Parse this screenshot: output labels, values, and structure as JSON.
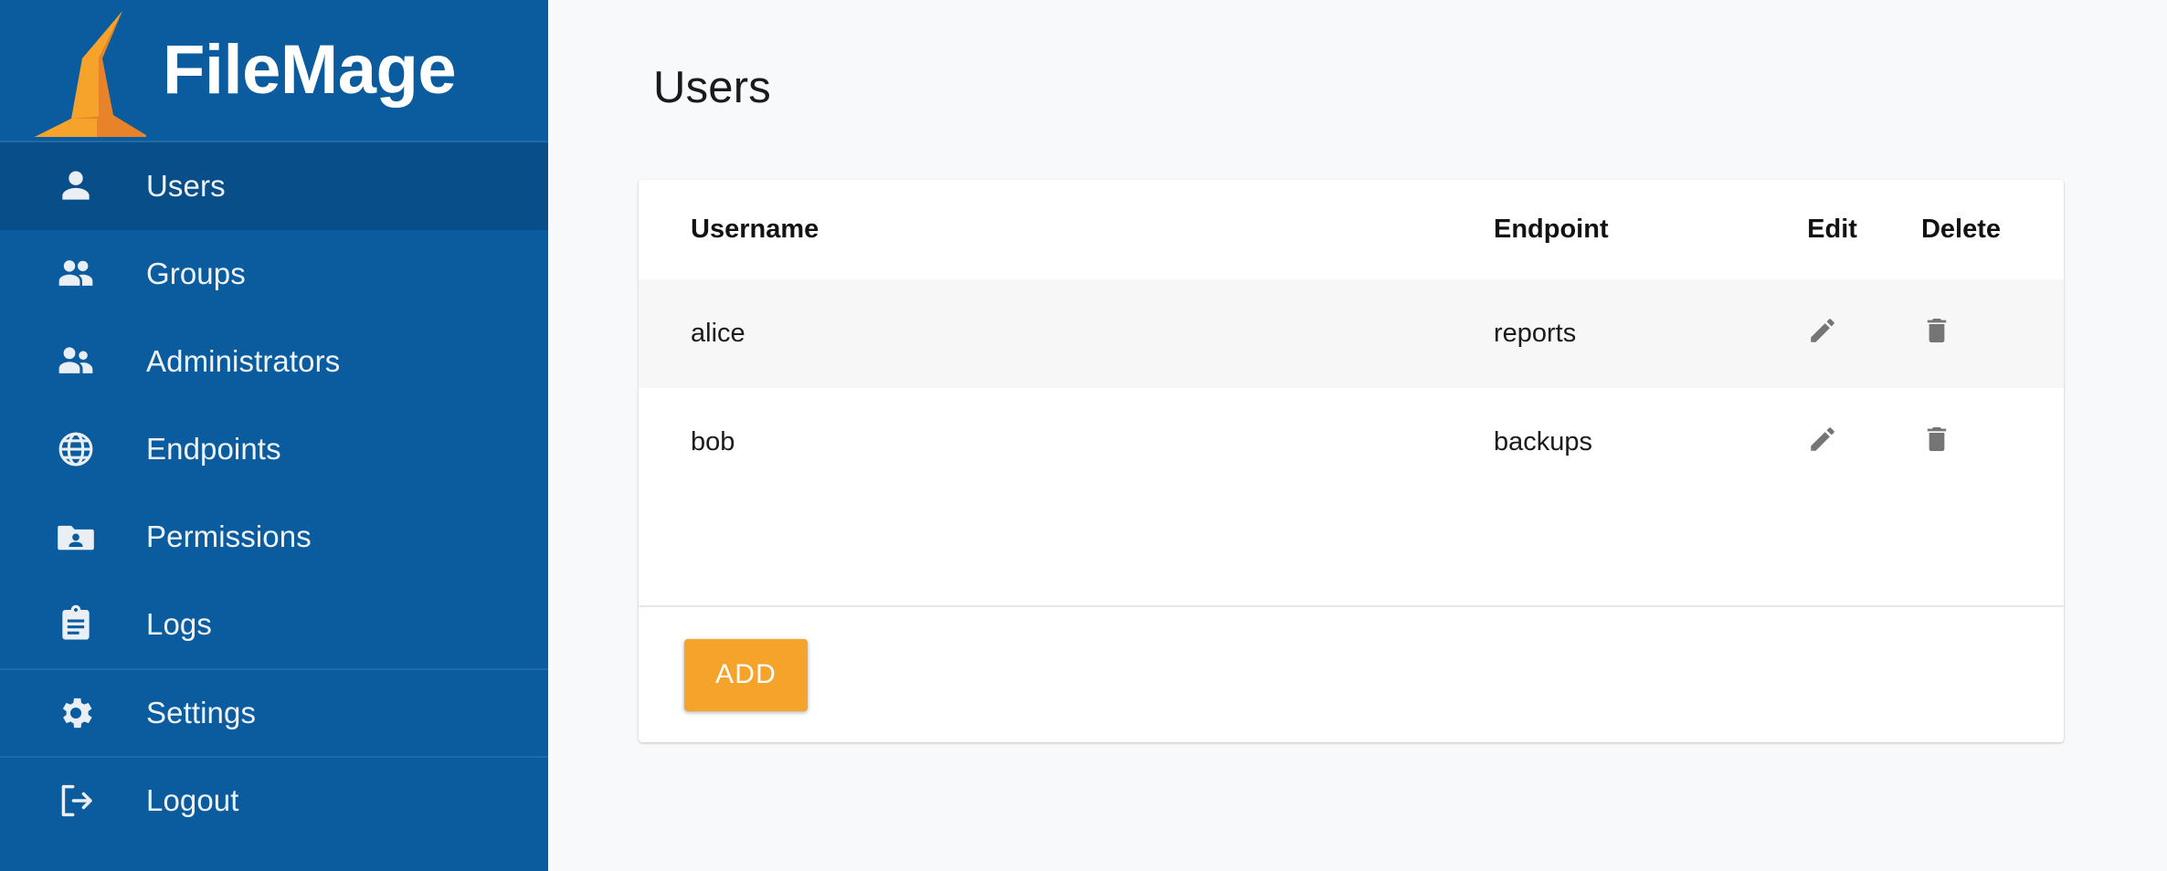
{
  "brand": {
    "title": "FileMage",
    "logo_icon": "wizard-hat-logo",
    "primary_color": "#0A5C9E",
    "accent_color": "#F5A32B"
  },
  "sidebar": {
    "items": [
      {
        "label": "Users",
        "icon": "person-icon",
        "active": true
      },
      {
        "label": "Groups",
        "icon": "people-icon",
        "active": false
      },
      {
        "label": "Administrators",
        "icon": "supervised-user-icon",
        "active": false
      },
      {
        "label": "Endpoints",
        "icon": "globe-icon",
        "active": false
      },
      {
        "label": "Permissions",
        "icon": "folder-shared-icon",
        "active": false
      },
      {
        "label": "Logs",
        "icon": "clipboard-icon",
        "active": false
      },
      {
        "label": "Settings",
        "icon": "gear-icon",
        "active": false
      },
      {
        "label": "Logout",
        "icon": "logout-icon",
        "active": false
      }
    ]
  },
  "main": {
    "page_title": "Users",
    "table": {
      "columns": [
        "Username",
        "Endpoint",
        "Edit",
        "Delete"
      ],
      "rows": [
        {
          "username": "alice",
          "endpoint": "reports",
          "edit_icon": "pencil-icon",
          "delete_icon": "trash-icon"
        },
        {
          "username": "bob",
          "endpoint": "backups",
          "edit_icon": "pencil-icon",
          "delete_icon": "trash-icon"
        }
      ]
    },
    "add_button_label": "ADD"
  }
}
